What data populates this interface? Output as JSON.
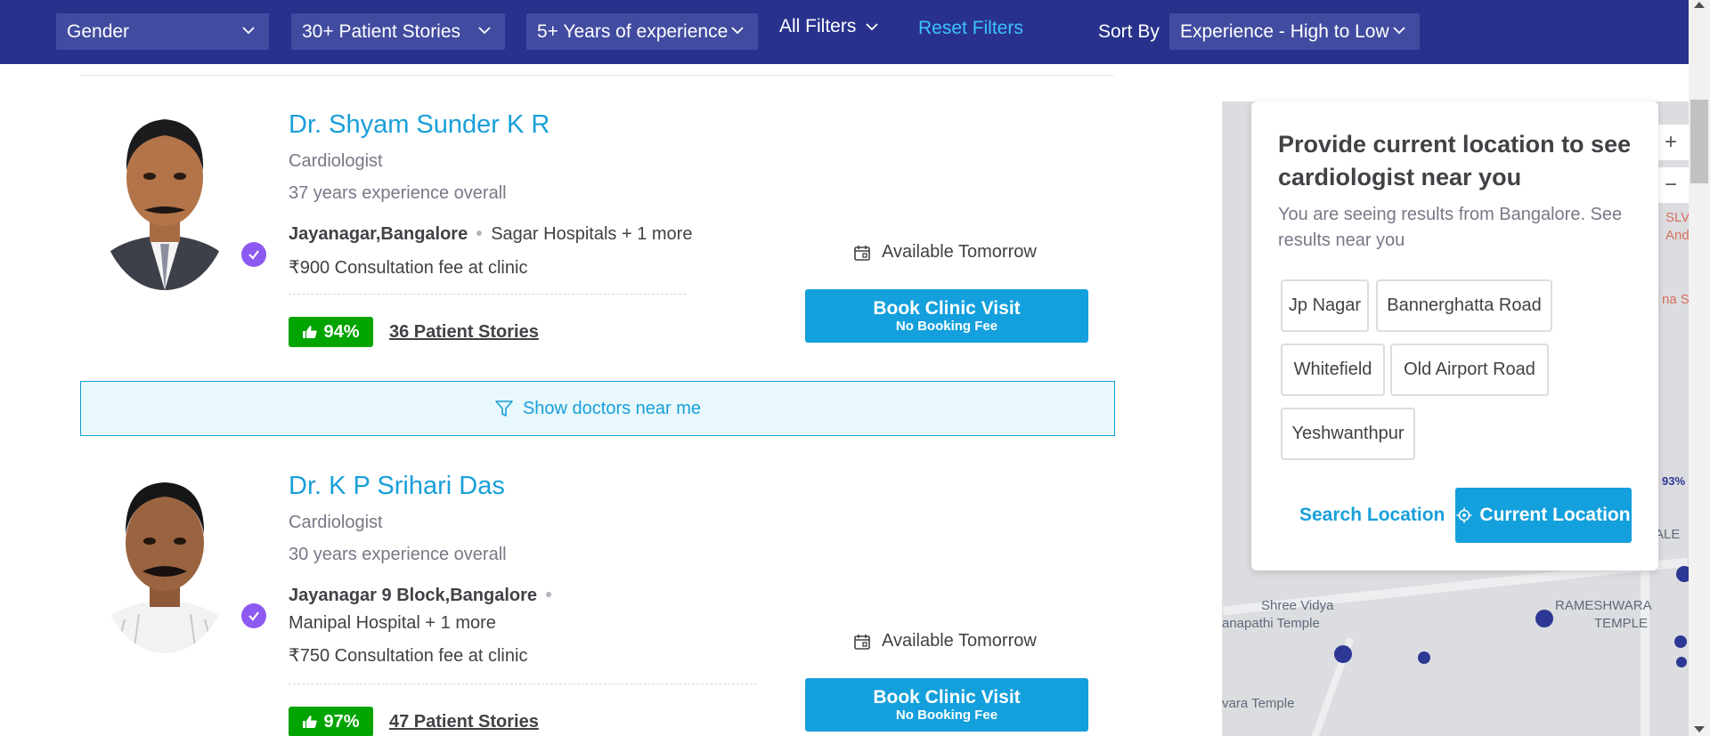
{
  "filters": {
    "gender": "Gender",
    "patient_stories": "30+ Patient Stories",
    "experience": "5+ Years of experience",
    "all_filters": "All Filters",
    "reset": "Reset Filters",
    "sort_by_label": "Sort By",
    "sort_value": "Experience - High to Low"
  },
  "doctors": [
    {
      "name": "Dr. Shyam Sunder K R",
      "specialty": "Cardiologist",
      "experience": "37 years experience overall",
      "locality": "Jayanagar,Bangalore",
      "clinic": "Sagar Hospitals + 1 more",
      "fee": "₹900 Consultation fee at clinic",
      "rating": "94%",
      "stories": "36 Patient Stories",
      "availability": "Available Tomorrow",
      "book_label": "Book Clinic Visit",
      "book_sub": "No Booking Fee"
    },
    {
      "name": "Dr. K P Srihari Das",
      "specialty": "Cardiologist",
      "experience": "30 years experience overall",
      "locality": "Jayanagar 9 Block,Bangalore",
      "clinic": "Manipal Hospital + 1 more",
      "fee": "₹750 Consultation fee at clinic",
      "rating": "97%",
      "stories": "47 Patient Stories",
      "availability": "Available Tomorrow",
      "book_label": "Book Clinic Visit",
      "book_sub": "No Booking Fee"
    }
  ],
  "near_me": "Show doctors near me",
  "location_panel": {
    "title": "Provide current location to see cardiologist near you",
    "subtitle": "You are seeing results from Bangalore. See results near you",
    "chips": [
      "Jp Nagar",
      "Bannerghatta Road",
      "Whitefield",
      "Old Airport Road",
      "Yeshwanthpur"
    ],
    "search_location": "Search Location",
    "current_location": "Current Location"
  },
  "map": {
    "zoom_in": "+",
    "zoom_out": "−",
    "labels": [
      "Shree Vidya",
      "anapathi Temple",
      "RAMESHWARA",
      "TEMPLE",
      "vara Temple",
      "ALE",
      "SLV",
      "And",
      "na S",
      "93%"
    ]
  },
  "colors": {
    "filterbar": "#28328c",
    "accent": "#14a0dc",
    "rating_green": "#01a400",
    "verified": "#8c5af0"
  }
}
